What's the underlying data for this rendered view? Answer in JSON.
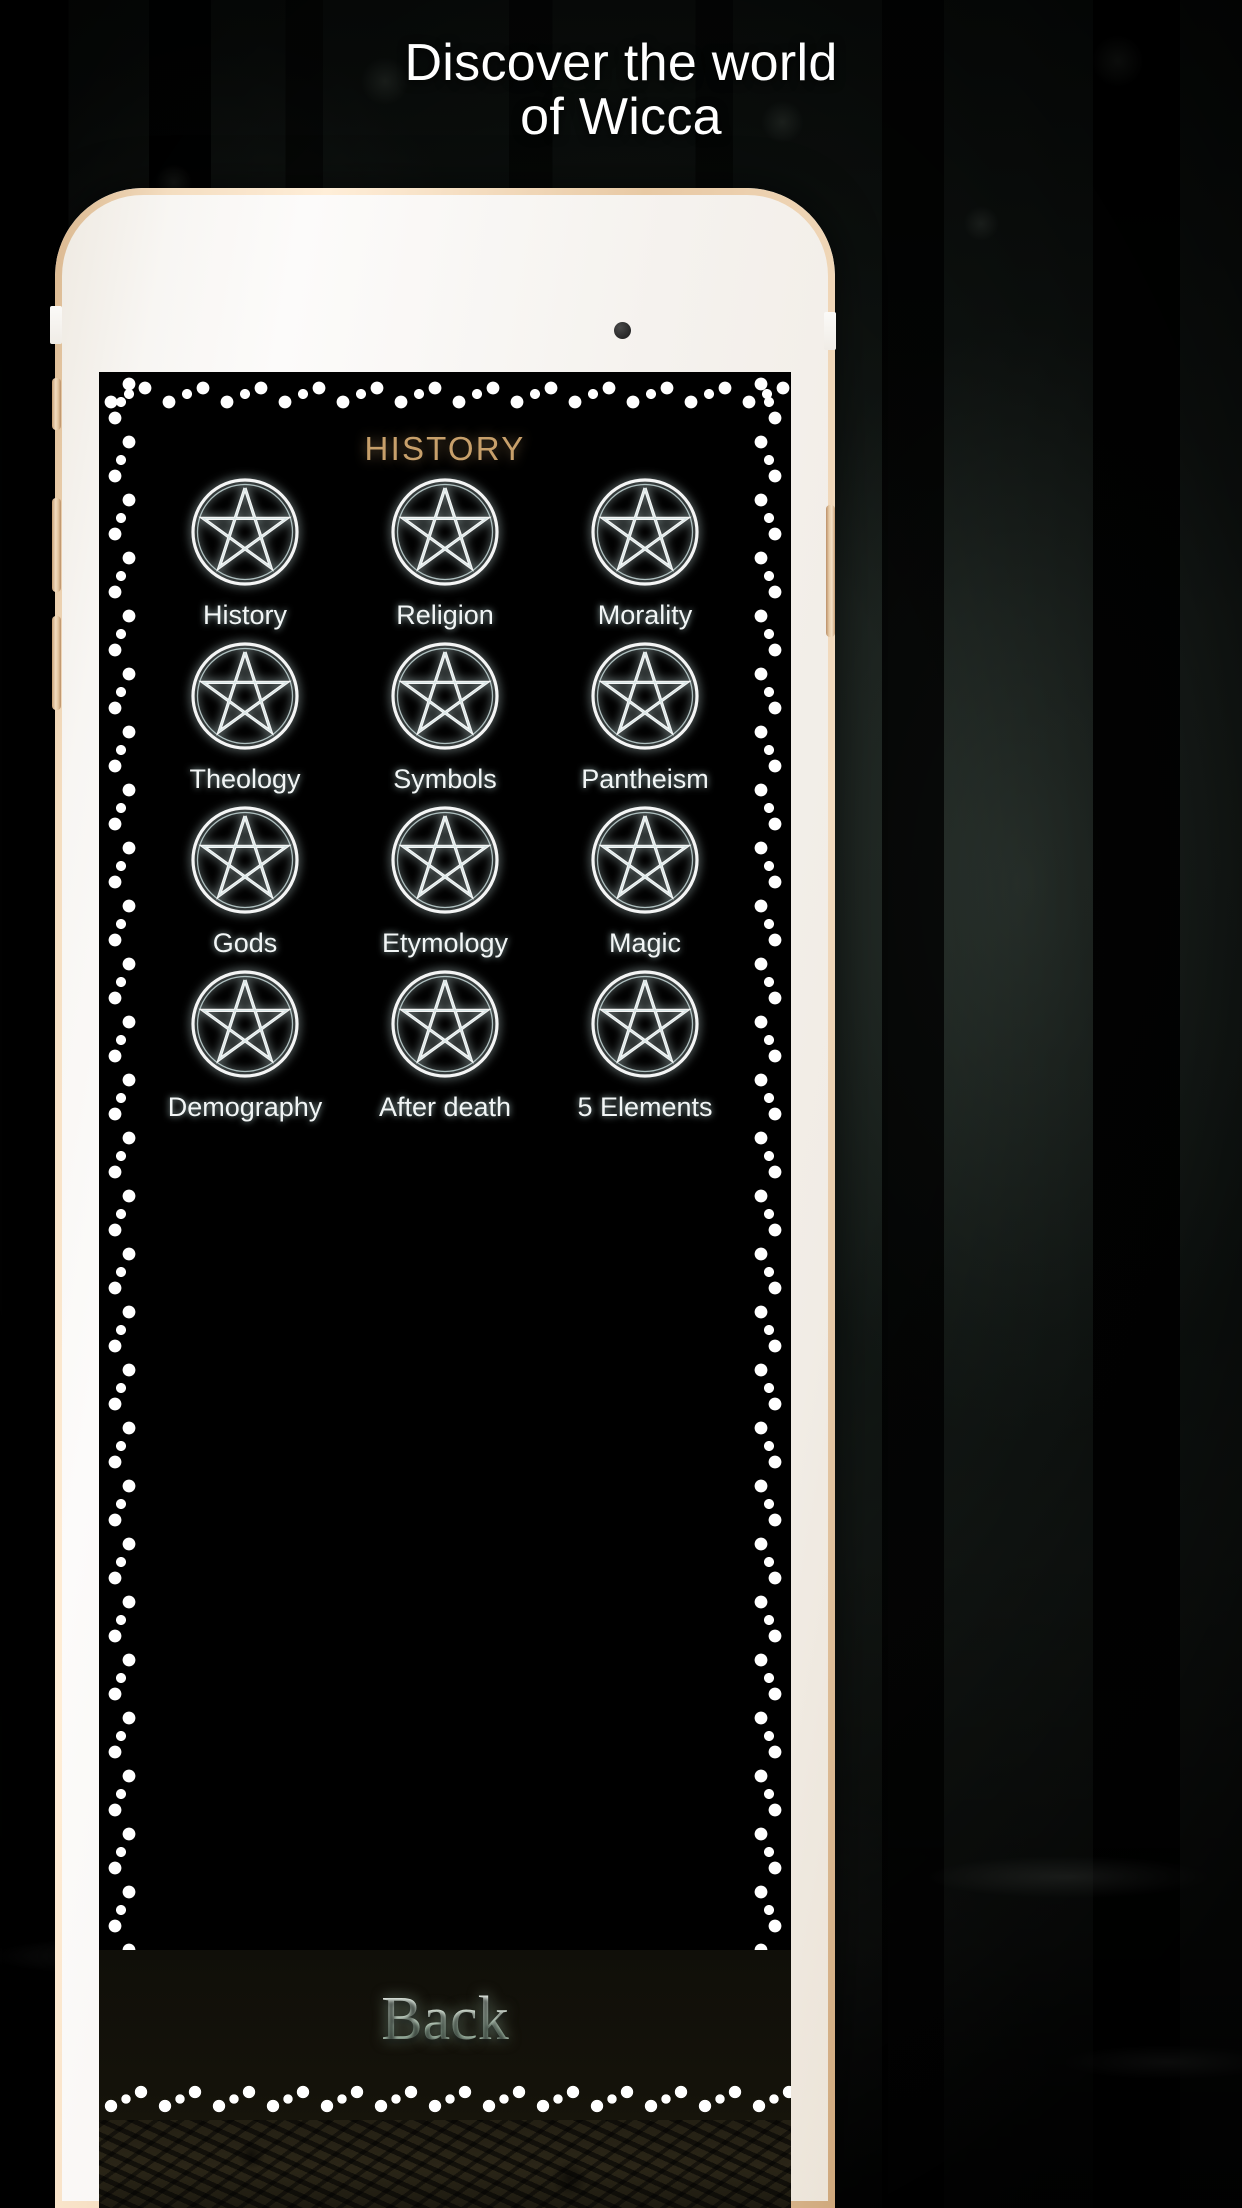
{
  "promo": {
    "headline_line1": "Discover the world",
    "headline_line2": "of Wicca",
    "headline_color": "#ffffff",
    "background": "dark forest photo"
  },
  "device": {
    "name": "white-gold-smartphone",
    "hardware": {
      "sensor": "proximity-sensor",
      "camera": "front-camera",
      "speaker": "earpiece-speaker",
      "buttons": [
        "silent-switch",
        "volume-up",
        "volume-down",
        "power"
      ]
    }
  },
  "app": {
    "section_title": "HISTORY",
    "title_color": "#c8a06b",
    "frame": "ornate-white-filigree-border",
    "background_color": "#000000",
    "icon": "pentacle-icon",
    "icon_color": "#f2f6f6",
    "grid": [
      {
        "label": "History",
        "icon": "pentacle-icon"
      },
      {
        "label": "Religion",
        "icon": "pentacle-icon"
      },
      {
        "label": "Morality",
        "icon": "pentacle-icon"
      },
      {
        "label": "Theology",
        "icon": "pentacle-icon"
      },
      {
        "label": "Symbols",
        "icon": "pentacle-icon"
      },
      {
        "label": "Pantheism",
        "icon": "pentacle-icon"
      },
      {
        "label": "Gods",
        "icon": "pentacle-icon"
      },
      {
        "label": "Etymology",
        "icon": "pentacle-icon"
      },
      {
        "label": "Magic",
        "icon": "pentacle-icon"
      },
      {
        "label": "Demography",
        "icon": "pentacle-icon"
      },
      {
        "label": "After death",
        "icon": "pentacle-icon"
      },
      {
        "label": "5 Elements",
        "icon": "pentacle-icon"
      }
    ],
    "footer": {
      "back_label": "Back",
      "back_color": "#eef4ea",
      "divider": "ornate-scroll-divider",
      "texture": "parchment-texture"
    }
  }
}
